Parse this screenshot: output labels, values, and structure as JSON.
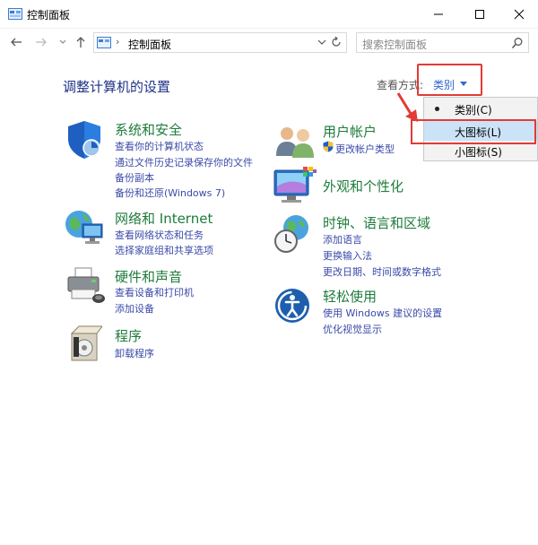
{
  "window": {
    "title": "控制面板"
  },
  "address": {
    "separator": "›",
    "path": "控制面板"
  },
  "search": {
    "placeholder": "搜索控制面板"
  },
  "main": {
    "heading": "调整计算机的设置",
    "view_by_label": "查看方式:",
    "view_by_value": "类别"
  },
  "view_menu": {
    "items": [
      {
        "label": "类别(C)",
        "selected": true
      },
      {
        "label": "大图标(L)",
        "highlighted": true
      },
      {
        "label": "小图标(S)"
      }
    ]
  },
  "categories": {
    "system": {
      "title": "系统和安全",
      "links": [
        "查看你的计算机状态",
        "通过文件历史记录保存你的文件",
        "备份副本",
        "备份和还原(Windows 7)"
      ]
    },
    "network": {
      "title": "网络和 Internet",
      "links": [
        "查看网络状态和任务",
        "选择家庭组和共享选项"
      ]
    },
    "hardware": {
      "title": "硬件和声音",
      "links": [
        "查看设备和打印机",
        "添加设备"
      ]
    },
    "programs": {
      "title": "程序",
      "links": [
        "卸载程序"
      ]
    },
    "users": {
      "title": "用户帐户",
      "links": [
        "更改帐户类型"
      ]
    },
    "appearance": {
      "title": "外观和个性化",
      "links": []
    },
    "clock": {
      "title": "时钟、语言和区域",
      "links": [
        "添加语言",
        "更换输入法",
        "更改日期、时间或数字格式"
      ]
    },
    "ease": {
      "title": "轻松使用",
      "links": [
        "使用 Windows 建议的设置",
        "优化视觉显示"
      ]
    }
  },
  "colors": {
    "heading": "#1e3287",
    "category_title": "#1e7b3b",
    "link": "#3a4aa8",
    "annotation": "#e23b35",
    "menu_highlight": "#cce3f7"
  }
}
